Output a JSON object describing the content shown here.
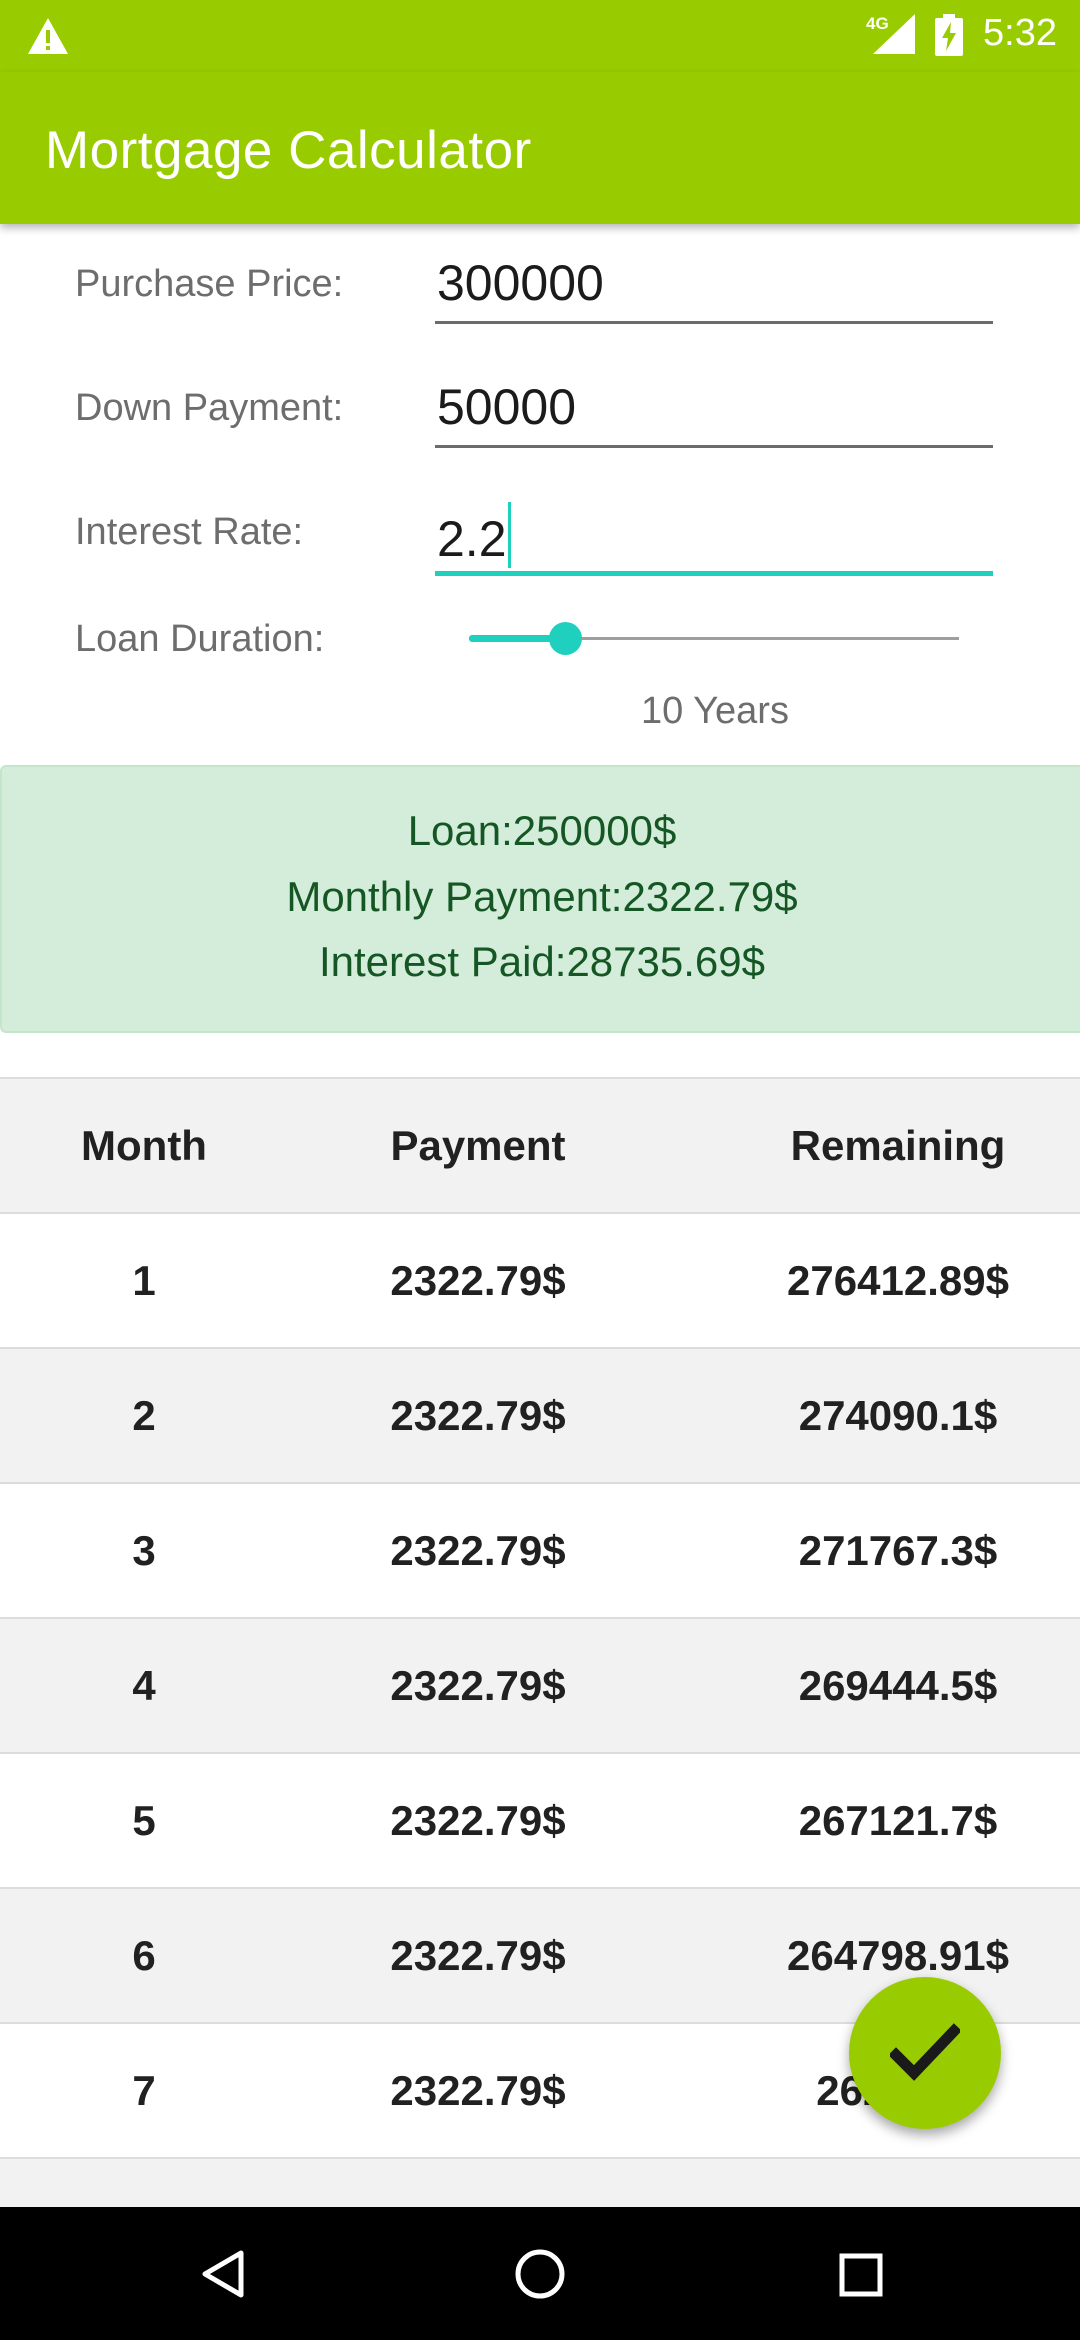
{
  "status_bar": {
    "time": "5:32",
    "network": "4G",
    "icons": [
      "warning-icon",
      "signal-icon",
      "battery-charging-icon"
    ]
  },
  "app_bar": {
    "title": "Mortgage Calculator"
  },
  "form": {
    "purchase_price": {
      "label": "Purchase Price:",
      "value": "300000"
    },
    "down_payment": {
      "label": "Down Payment:",
      "value": "50000"
    },
    "interest_rate": {
      "label": "Interest Rate:",
      "value": "2.2"
    },
    "loan_duration": {
      "label": "Loan Duration:",
      "caption": "10 Years",
      "slider_fraction": 0.2
    }
  },
  "summary": {
    "loan": "Loan:250000$",
    "monthly_payment": "Monthly Payment:2322.79$",
    "interest_paid": "Interest Paid:28735.69$"
  },
  "table": {
    "headers": [
      "Month",
      "Payment",
      "Remaining"
    ],
    "rows": [
      [
        "1",
        "2322.79$",
        "276412.89$"
      ],
      [
        "2",
        "2322.79$",
        "274090.1$"
      ],
      [
        "3",
        "2322.79$",
        "271767.3$"
      ],
      [
        "4",
        "2322.79$",
        "269444.5$"
      ],
      [
        "5",
        "2322.79$",
        "267121.7$"
      ],
      [
        "6",
        "2322.79$",
        "264798.91$"
      ],
      [
        "7",
        "2322.79$",
        "2624__$"
      ]
    ]
  },
  "fab": {
    "icon": "check-icon"
  },
  "nav_bar": {
    "icons": [
      "back-icon",
      "home-icon",
      "recents-icon"
    ]
  },
  "colors": {
    "primary": "#99cc00",
    "accent": "#1fd0bf",
    "summary_bg": "#d4ecda",
    "summary_text": "#155724"
  }
}
